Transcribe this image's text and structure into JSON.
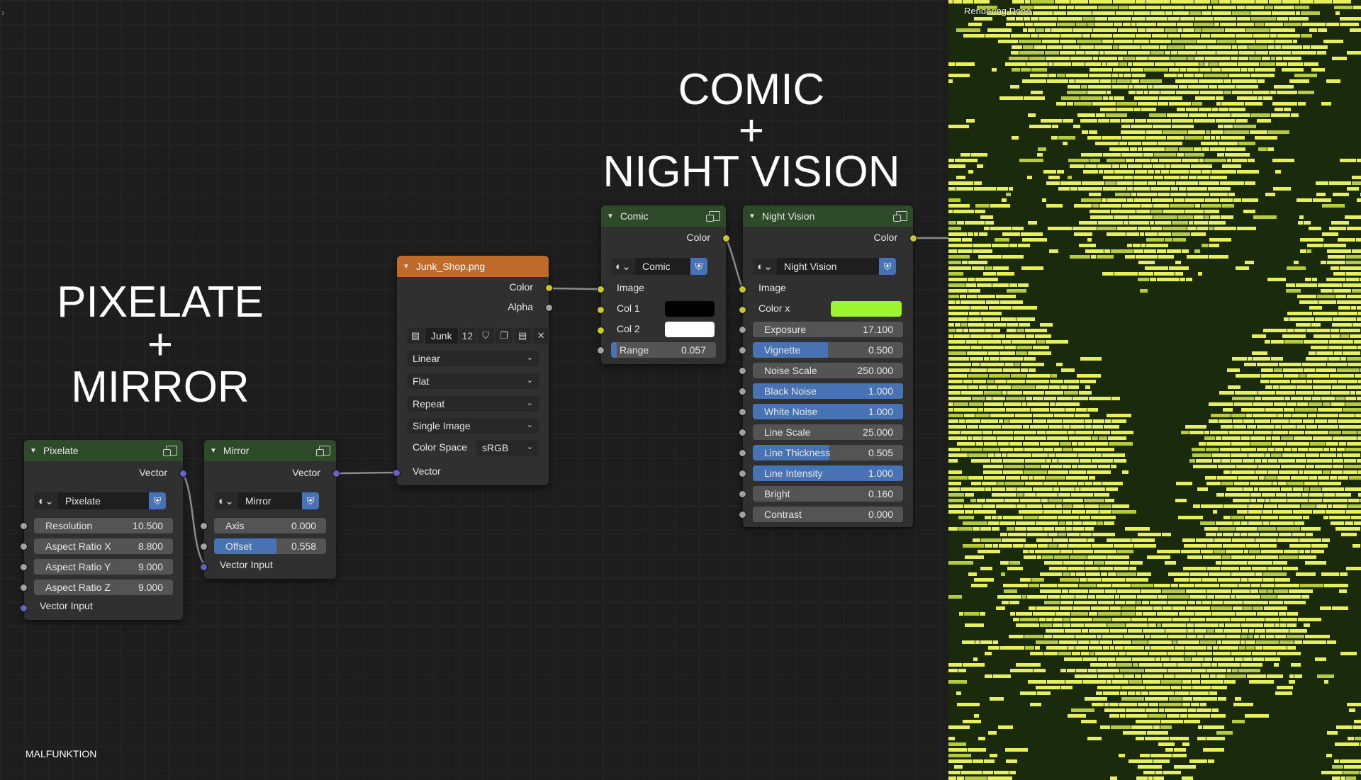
{
  "titles": {
    "left": [
      "PIXELATE",
      "+",
      "MIRROR"
    ],
    "right": [
      "COMIC",
      "+",
      "NIGHT VISION"
    ]
  },
  "credit": "MALFUNKTION",
  "render": {
    "status": "Rendering Done"
  },
  "colors": {
    "accent": "#4772b3",
    "node_header_group": "#2d4a29",
    "node_header_image": "#c06a2c",
    "night_vision_color_x": "#9cf52e"
  },
  "nodes": {
    "pixelate": {
      "title": "Pixelate",
      "output": "Vector",
      "group_name": "Pixelate",
      "fields": [
        {
          "label": "Resolution",
          "value": "10.500"
        },
        {
          "label": "Aspect Ratio X",
          "value": "8.800"
        },
        {
          "label": "Aspect Ratio Y",
          "value": "9.000"
        },
        {
          "label": "Aspect Ratio Z",
          "value": "9.000"
        }
      ],
      "input": "Vector Input"
    },
    "mirror": {
      "title": "Mirror",
      "output": "Vector",
      "group_name": "Mirror",
      "fields": [
        {
          "label": "Axis",
          "value": "0.000",
          "fill": 0
        },
        {
          "label": "Offset",
          "value": "0.558",
          "fill": 0.558
        }
      ],
      "input": "Vector Input"
    },
    "image": {
      "title": "Junk_Shop.png",
      "outputs": [
        "Color",
        "Alpha"
      ],
      "image_name": "Junk",
      "user_count": "12",
      "interpolation": "Linear",
      "projection": "Flat",
      "extension": "Repeat",
      "source": "Single Image",
      "color_space_label": "Color Space",
      "color_space": "sRGB",
      "input": "Vector"
    },
    "comic": {
      "title": "Comic",
      "output": "Color",
      "group_name": "Comic",
      "image_input": "Image",
      "col1_label": "Col 1",
      "col1": "#000000",
      "col2_label": "Col 2",
      "col2": "#ffffff",
      "range_label": "Range",
      "range_value": "0.057",
      "range_fill": 0.057
    },
    "night_vision": {
      "title": "Night Vision",
      "output": "Color",
      "group_name": "Night Vision",
      "image_input": "Image",
      "color_x_label": "Color x",
      "fields": [
        {
          "label": "Exposure",
          "value": "17.100",
          "fill": 0
        },
        {
          "label": "Vignette",
          "value": "0.500",
          "fill": 0.5
        },
        {
          "label": "Noise Scale",
          "value": "250.000",
          "fill": 0
        },
        {
          "label": "Black Noise",
          "value": "1.000",
          "fill": 1
        },
        {
          "label": "White Noise",
          "value": "1.000",
          "fill": 1
        },
        {
          "label": "Line Scale",
          "value": "25.000",
          "fill": 0
        },
        {
          "label": "Line Thickness",
          "value": "0.505",
          "fill": 0.505
        },
        {
          "label": "Line Intensity",
          "value": "1.000",
          "fill": 1
        },
        {
          "label": "Bright",
          "value": "0.160",
          "fill": 0
        },
        {
          "label": "Contrast",
          "value": "0.000",
          "fill": 0
        }
      ]
    }
  }
}
